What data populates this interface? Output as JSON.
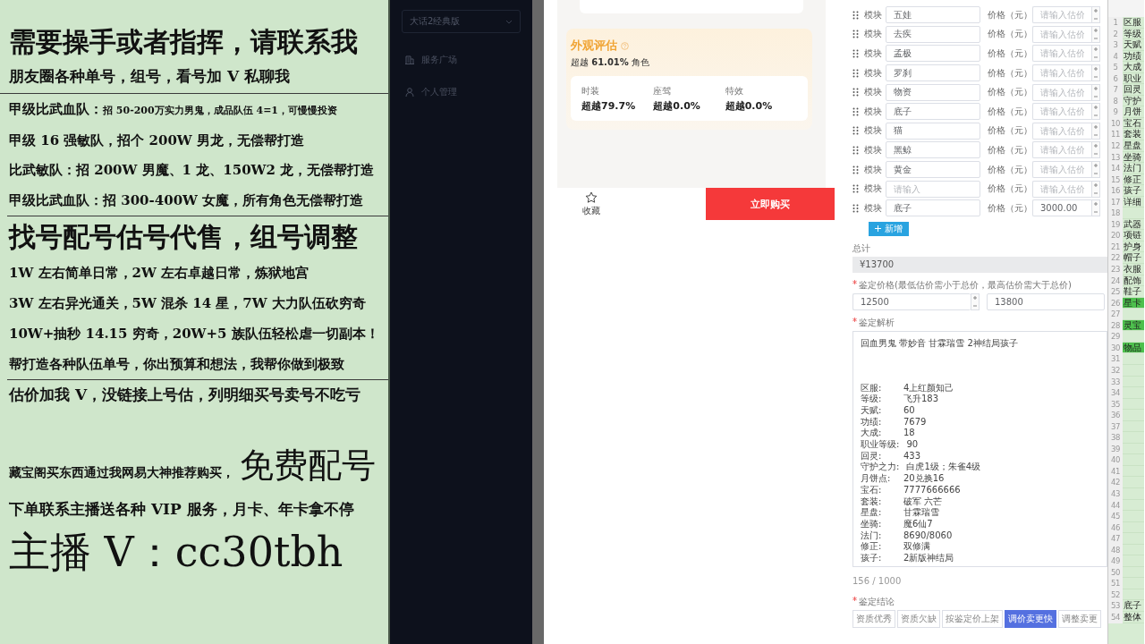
{
  "promo_panel": {
    "sections": [
      {
        "lines": [
          {
            "kind": "headline",
            "text": "需要操手或者指挥，请联系我"
          },
          {
            "kind": "subhead",
            "text": "朋友圈各种单号，组号，看号加 V 私聊我"
          }
        ]
      },
      {
        "lines": [
          {
            "kind": "mixed",
            "parts": [
              {
                "kind": "lead",
                "text": "甲级比武血队："
              },
              {
                "kind": "fine",
                "text": "招 50-200万实力男鬼，成品队伍 4=1，可慢慢投资"
              }
            ]
          },
          {
            "kind": "line",
            "text": "甲级 16 强敏队，招个 200W 男龙，无偿帮打造"
          },
          {
            "kind": "line",
            "text": "比武敏队：招 200W 男魔、1 龙、150W2 龙，无偿帮打造"
          },
          {
            "kind": "line",
            "text": "甲级比武血队：招 300-400W 女魔，所有角色无偿帮打造"
          }
        ]
      },
      {
        "lines": [
          {
            "kind": "headline",
            "text": "找号配号估号代售，组号调整"
          },
          {
            "kind": "line",
            "text": "1W 左右简单日常，2W 左右卓越日常，炼狱地宫"
          },
          {
            "kind": "line",
            "text": "3W 左右异光通关，5W 混杀 14 星，7W 大力队伍砍穷奇"
          },
          {
            "kind": "line",
            "text": "10W+抽秒 14.15 穷奇，20W+5 族队伍轻松虐一切副本！"
          },
          {
            "kind": "line",
            "text": "帮打造各种队伍单号，你出预算和想法，我帮你做到极致"
          }
        ]
      },
      {
        "lines": [
          {
            "kind": "subhead",
            "text": "估价加我 V，没链接上号估，列明细买号卖号不吃亏"
          },
          {
            "kind": "banner",
            "parts": [
              {
                "kind": "fine",
                "text": "藏宝阁买东西通过我网易大神推荐购买，"
              },
              {
                "kind": "display",
                "text": "免费配号"
              }
            ]
          },
          {
            "kind": "subhead",
            "text": "下单联系主播送各种 VIP 服务，月卡、年卡拿不停"
          },
          {
            "kind": "contact",
            "text": "主播 V：cc30tbh"
          }
        ]
      }
    ]
  },
  "sidebar": {
    "game_select": "大话2经典版",
    "menu": [
      {
        "kind": "plaza",
        "label": "服务广场"
      },
      {
        "kind": "profile",
        "label": "个人管理"
      }
    ]
  },
  "preview": {
    "appearance": {
      "title": "外观评估",
      "summary": "超越 **61.01%** 角色",
      "stats": [
        {
          "label": "时装",
          "value": "超越79.7%"
        },
        {
          "label": "座驾",
          "value": "超越0.0%"
        },
        {
          "label": "特效",
          "value": "超越0.0%"
        }
      ]
    },
    "favorite": "收藏",
    "buy_button": "立即购买"
  },
  "form": {
    "modules": [
      {
        "label": "模块",
        "name": "五娃",
        "price_label": "价格（元）",
        "price_placeholder": "请输入估价"
      },
      {
        "label": "模块",
        "name": "去疾",
        "price_label": "价格（元）",
        "price_placeholder": "请输入估价"
      },
      {
        "label": "模块",
        "name": "孟极",
        "price_label": "价格（元）",
        "price_placeholder": "请输入估价"
      },
      {
        "label": "模块",
        "name": "罗刹",
        "price_label": "价格（元）",
        "price_placeholder": "请输入估价"
      },
      {
        "label": "模块",
        "name": "物资",
        "price_label": "价格（元）",
        "price_placeholder": "请输入估价"
      },
      {
        "label": "模块",
        "name": "底子",
        "price_label": "价格（元）",
        "price_placeholder": "请输入估价"
      },
      {
        "label": "模块",
        "name": "猫",
        "price_label": "价格（元）",
        "price_placeholder": "请输入估价"
      },
      {
        "label": "模块",
        "name": "黑鲸",
        "price_label": "价格（元）",
        "price_placeholder": "请输入估价"
      },
      {
        "label": "模块",
        "name": "黄金",
        "price_label": "价格（元）",
        "price_placeholder": "请输入估价"
      },
      {
        "label": "模块",
        "name_placeholder": "请输入",
        "price_label": "价格（元）",
        "price_placeholder": "请输入估价"
      },
      {
        "label": "模块",
        "name": "底子",
        "price_label": "价格（元）",
        "price": "3000.00"
      }
    ],
    "add_button": "新增",
    "total": {
      "label": "总计",
      "value": "¥13700"
    },
    "appraisal_price": {
      "label": "鉴定价格(最低估价需小于总价，最高估价需大于总价)",
      "required": true,
      "min": "12500",
      "max": "13800"
    },
    "analysis": {
      "label": "鉴定解析",
      "required": true,
      "intro": "回血男鬼 带妙音 甘霖瑞雪 2神结局孩子",
      "fields": [
        {
          "key": "区服:",
          "value": "4上红颜知己"
        },
        {
          "key": "等级:",
          "value": "飞升183"
        },
        {
          "key": "天赋:",
          "value": "60"
        },
        {
          "key": "功绩:",
          "value": "7679"
        },
        {
          "key": "大成:",
          "value": "18"
        },
        {
          "key": "职业等级:",
          "value": "90"
        },
        {
          "key": "回灵:",
          "value": "433"
        },
        {
          "key": "守护之力:",
          "value": "白虎1级；朱雀4级"
        },
        {
          "key": "月饼点:",
          "value": "20兑换16"
        },
        {
          "key": "宝石:",
          "value": "7777666666"
        },
        {
          "key": "套装:",
          "value": "破军 六芒"
        },
        {
          "key": "星盘:",
          "value": "甘霖瑞雪"
        },
        {
          "key": "坐骑:",
          "value": "魔6仙7"
        },
        {
          "key": "法门:",
          "value": "8690/8060"
        },
        {
          "key": "修正:",
          "value": "双修满"
        },
        {
          "key": "孩子:",
          "value": "2新版神结局"
        }
      ],
      "counter": "156 / 1000"
    },
    "conclusion": {
      "label": "鉴定结论",
      "required": true,
      "options": [
        {
          "label": "资质优秀",
          "selected": false
        },
        {
          "label": "资质欠缺",
          "selected": false
        },
        {
          "label": "按鉴定价上架",
          "selected": false
        },
        {
          "label": "调价卖更快",
          "selected": true
        },
        {
          "label": "调整卖更",
          "selected": false
        }
      ]
    }
  },
  "sheet": {
    "rows": [
      {
        "num": "1",
        "text": "区服",
        "highlighted": false
      },
      {
        "num": "2",
        "text": "等级",
        "highlighted": false
      },
      {
        "num": "3",
        "text": "天赋",
        "highlighted": false
      },
      {
        "num": "4",
        "text": "功绩",
        "highlighted": false
      },
      {
        "num": "5",
        "text": "大成",
        "highlighted": false
      },
      {
        "num": "6",
        "text": "职业",
        "highlighted": false
      },
      {
        "num": "7",
        "text": "回灵",
        "highlighted": false
      },
      {
        "num": "8",
        "text": "守护",
        "highlighted": false
      },
      {
        "num": "9",
        "text": "月饼",
        "highlighted": false
      },
      {
        "num": "10",
        "text": "宝石",
        "highlighted": false
      },
      {
        "num": "11",
        "text": "套装",
        "highlighted": false
      },
      {
        "num": "12",
        "text": "星盘",
        "highlighted": false
      },
      {
        "num": "13",
        "text": "坐骑",
        "highlighted": false
      },
      {
        "num": "14",
        "text": "法门",
        "highlighted": false
      },
      {
        "num": "15",
        "text": "修正",
        "highlighted": false
      },
      {
        "num": "16",
        "text": "孩子",
        "highlighted": false
      },
      {
        "num": "17",
        "text": "详细",
        "highlighted": false
      },
      {
        "num": "18",
        "highlighted": false
      },
      {
        "num": "19",
        "text": "武器",
        "highlighted": false
      },
      {
        "num": "20",
        "text": "项链",
        "highlighted": false
      },
      {
        "num": "21",
        "text": "护身",
        "highlighted": false
      },
      {
        "num": "22",
        "text": "帽子",
        "highlighted": false
      },
      {
        "num": "23",
        "text": "衣服",
        "highlighted": false
      },
      {
        "num": "24",
        "text": "配饰",
        "highlighted": false
      },
      {
        "num": "25",
        "text": "鞋子",
        "highlighted": false
      },
      {
        "num": "26",
        "text": "星卡",
        "highlighted": true
      },
      {
        "num": "27",
        "highlighted": false
      },
      {
        "num": "28",
        "text": "灵宝",
        "highlighted": true
      },
      {
        "num": "29",
        "highlighted": false
      },
      {
        "num": "30",
        "text": "物品",
        "highlighted": true
      },
      {
        "num": "31",
        "highlighted": false
      },
      {
        "num": "32",
        "highlighted": false
      },
      {
        "num": "33",
        "highlighted": false
      },
      {
        "num": "34",
        "highlighted": false
      },
      {
        "num": "35",
        "highlighted": false
      },
      {
        "num": "36",
        "highlighted": false
      },
      {
        "num": "37",
        "highlighted": false
      },
      {
        "num": "38",
        "highlighted": false
      },
      {
        "num": "39",
        "highlighted": false
      },
      {
        "num": "40",
        "highlighted": false
      },
      {
        "num": "41",
        "highlighted": false
      },
      {
        "num": "42",
        "highlighted": false
      },
      {
        "num": "43",
        "highlighted": false
      },
      {
        "num": "44",
        "highlighted": false
      },
      {
        "num": "45",
        "highlighted": false
      },
      {
        "num": "46",
        "highlighted": false
      },
      {
        "num": "47",
        "highlighted": false
      },
      {
        "num": "48",
        "highlighted": false
      },
      {
        "num": "49",
        "highlighted": false
      },
      {
        "num": "50",
        "highlighted": false
      },
      {
        "num": "51",
        "highlighted": false
      },
      {
        "num": "52",
        "highlighted": false
      },
      {
        "num": "53",
        "text": "底子",
        "highlighted": false
      },
      {
        "num": "54",
        "text": "整体",
        "highlighted": false
      }
    ]
  }
}
